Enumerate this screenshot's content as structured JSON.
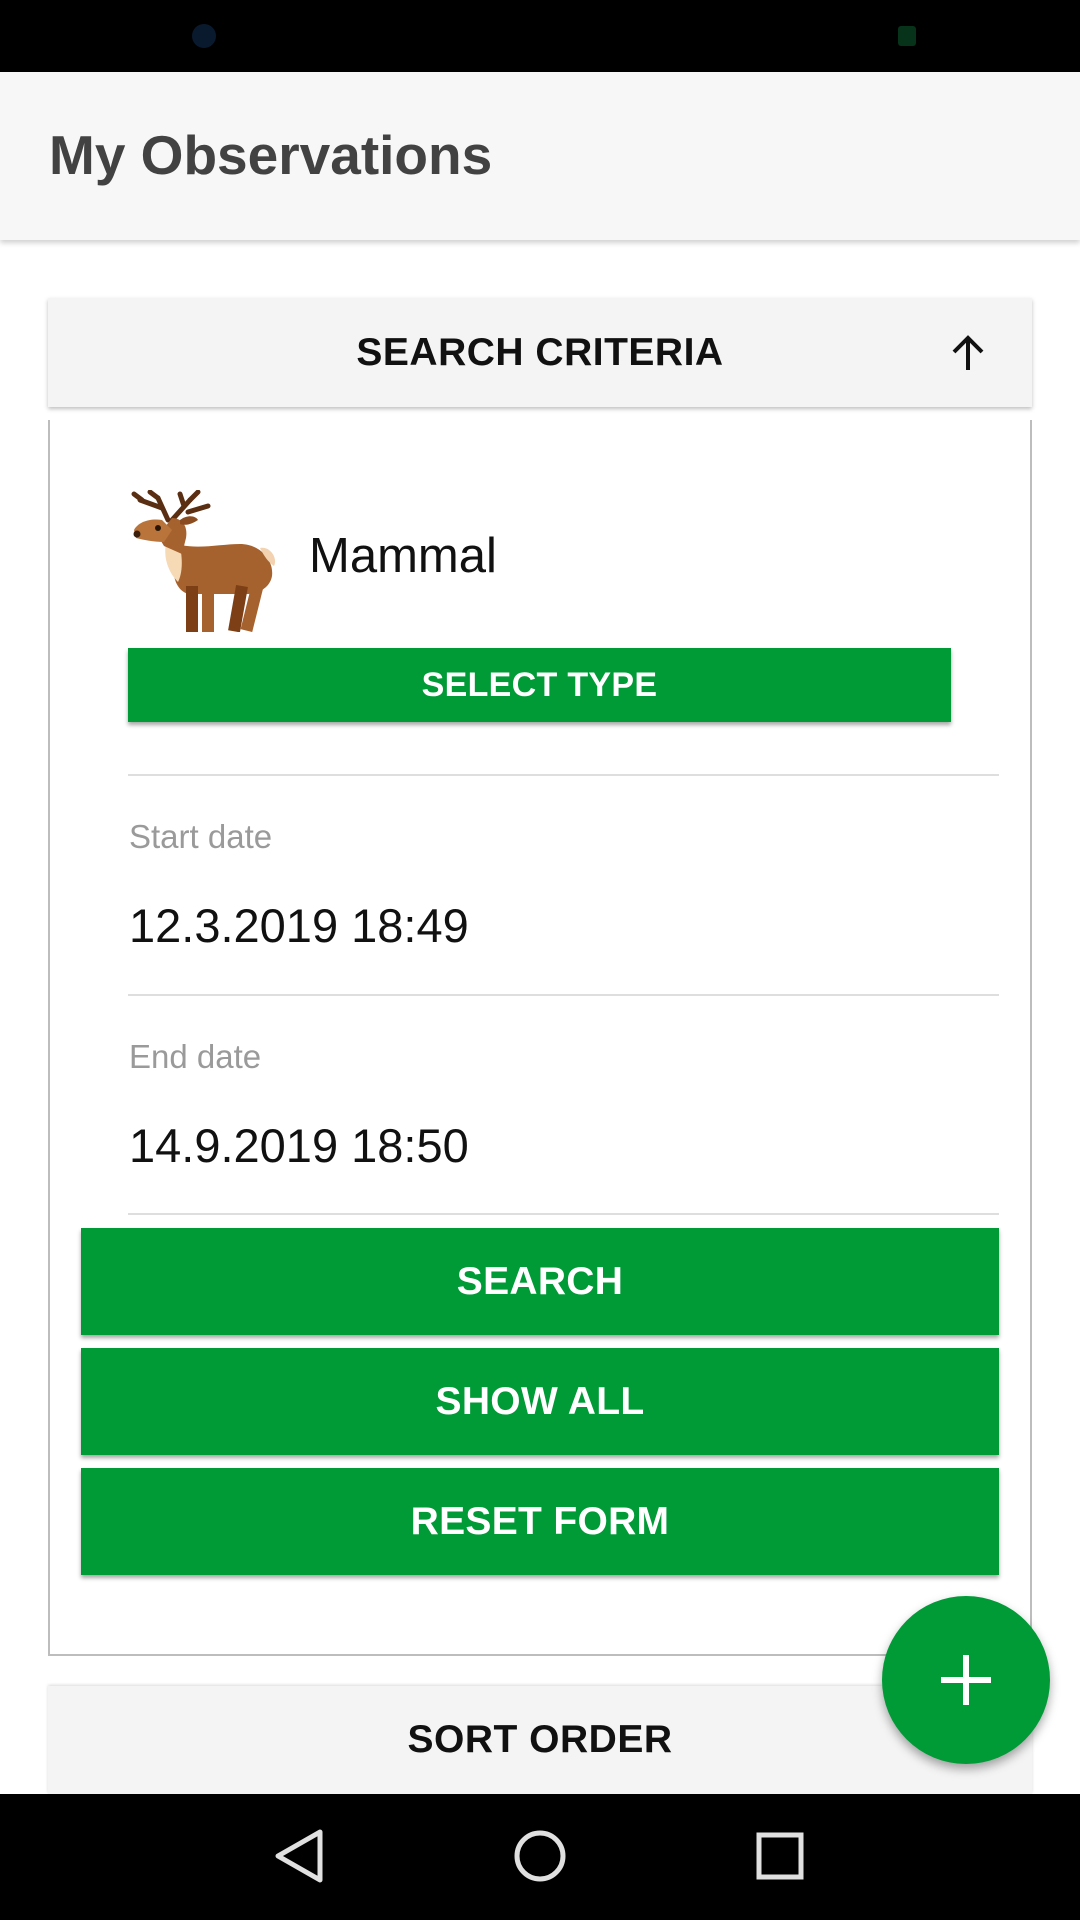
{
  "app": {
    "title": "My Observations"
  },
  "search_criteria": {
    "header_label": "SEARCH CRITERIA",
    "toggle_icon": "arrow-up-icon",
    "type": {
      "icon": "deer-icon",
      "label": "Mammal",
      "select_button": "SELECT TYPE"
    },
    "start_date": {
      "label": "Start date",
      "value": "12.3.2019 18:49"
    },
    "end_date": {
      "label": "End date",
      "value": "14.9.2019 18:50"
    },
    "buttons": {
      "search": "SEARCH",
      "show_all": "SHOW ALL",
      "reset": "RESET FORM"
    }
  },
  "sort_order": {
    "header_label": "SORT ORDER"
  },
  "fab": {
    "icon": "plus-icon"
  },
  "navigation": {
    "back_icon": "back-triangle-icon",
    "home_icon": "home-circle-icon",
    "recent_icon": "recent-square-icon"
  },
  "colors": {
    "accent": "#009a37",
    "app_bar": "#f7f7f7",
    "header_bg": "#f4f4f4",
    "system_bars": "#000000"
  }
}
